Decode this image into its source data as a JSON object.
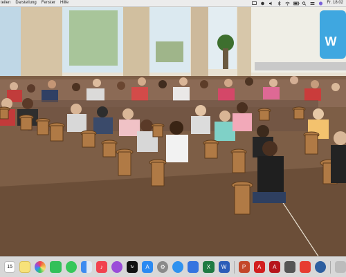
{
  "menubar": {
    "app_menus": [
      "Datei",
      "Darstellung",
      "Fenster",
      "Hilfe"
    ],
    "visible_menu_labels": [
      "teilen",
      "Darstellung",
      "Fenster",
      "Hilfe"
    ],
    "status_icons": [
      "screen-mirror-icon",
      "record-icon",
      "speaker-icon",
      "bluetooth-icon",
      "wifi-icon",
      "battery-icon",
      "search-icon",
      "control-center-icon",
      "siri-icon"
    ],
    "clock": "Fr. 18:02"
  },
  "video": {
    "wall_letter": "W",
    "scene": "classroom-drum-circle"
  },
  "dock": {
    "calendar_day": "15",
    "items": [
      "calendar-icon",
      "notes-icon",
      "photos-icon",
      "facetime-icon",
      "messages-icon",
      "finder-icon",
      "music-icon",
      "podcasts-icon",
      "apple-tv-icon",
      "app-store-icon",
      "system-preferences-icon",
      "safari-icon",
      "keynote-icon",
      "excel-icon",
      "word-icon",
      "powerpoint-icon",
      "acrobat-icon",
      "acrobat-reader-icon",
      "teamviewer-icon",
      "anydesk-icon",
      "browser-icon",
      "trash-icon"
    ],
    "colors": {
      "calendar": "#ffffff",
      "notes": "#f7e27a",
      "photos": "#f0a040",
      "facetime": "#33c05a",
      "messages": "#36c75a",
      "finder": "#3d8bf0",
      "music": "#f2424f",
      "podcasts": "#9b4cd9",
      "appletv": "#111111",
      "appstore": "#2b8af2",
      "sysprefs": "#8a8a8a",
      "safari": "#2f92ef",
      "keynote": "#3574e0",
      "excel": "#1f7a43",
      "word": "#2b5cb8",
      "powerpoint": "#c4472a",
      "acrobat": "#d21f1f",
      "reader": "#b7151b",
      "teamviewer": "#555555",
      "anydesk": "#e73c31",
      "browser": "#2d5fa0",
      "trash": "#bcbcbc"
    }
  }
}
